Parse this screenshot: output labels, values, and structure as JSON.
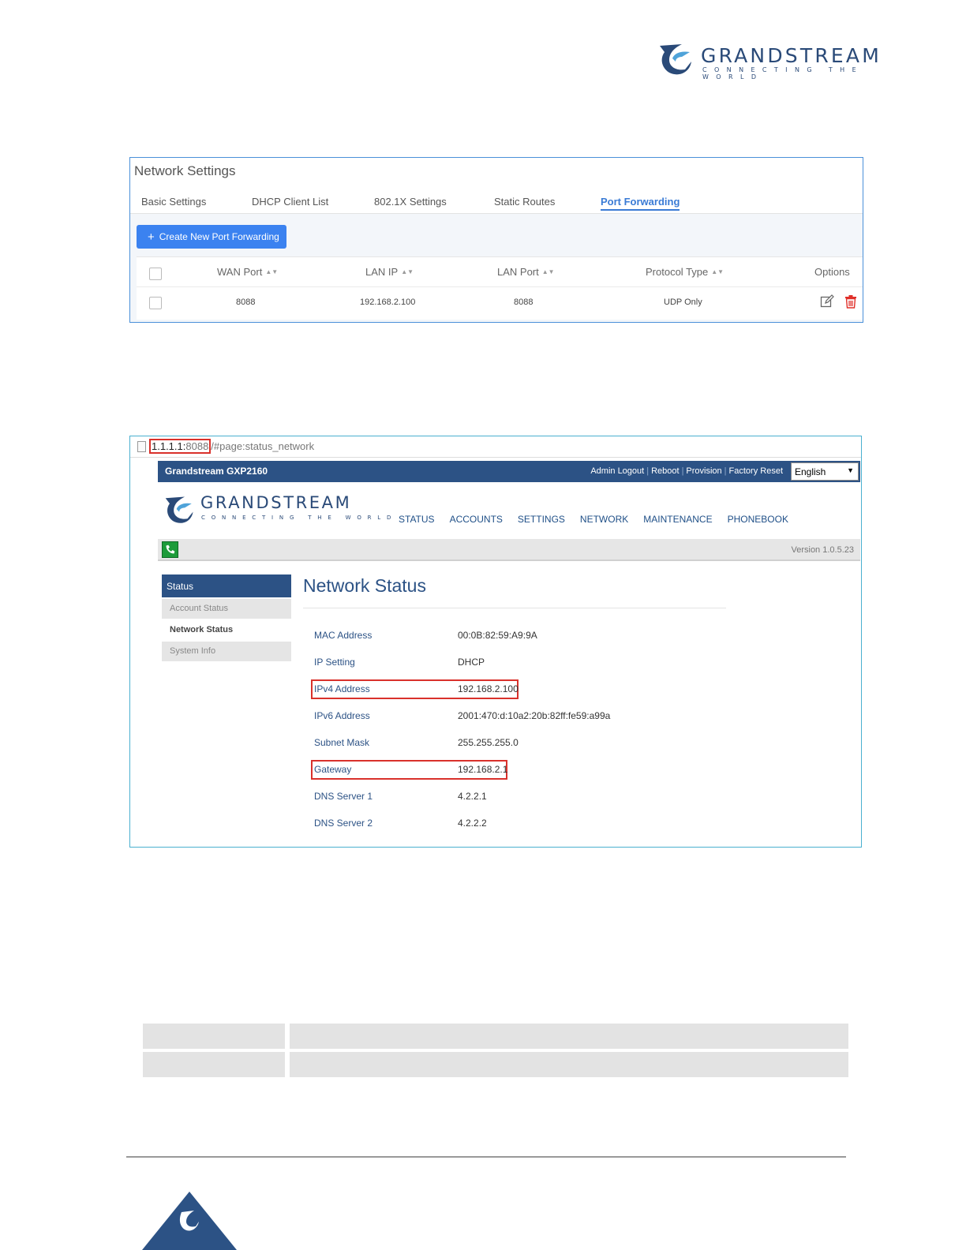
{
  "logo": {
    "wordmark": "GRANDSTREAM",
    "tagline": "CONNECTING THE WORLD",
    "icon": "grandstream-logo-icon"
  },
  "network_settings": {
    "title": "Network Settings",
    "tabs": [
      {
        "label": "Basic Settings",
        "active": false
      },
      {
        "label": "DHCP Client List",
        "active": false
      },
      {
        "label": "802.1X Settings",
        "active": false
      },
      {
        "label": "Static Routes",
        "active": false
      },
      {
        "label": "Port Forwarding",
        "active": true
      }
    ],
    "create_button": "Create New Port Forwarding",
    "columns": [
      "WAN Port",
      "LAN IP",
      "LAN Port",
      "Protocol Type",
      "Options"
    ],
    "rows": [
      {
        "wan_port": "8088",
        "lan_ip": "192.168.2.100",
        "lan_port": "8088",
        "protocol": "UDP Only"
      }
    ],
    "accent_color": "#3b82f0",
    "delete_color": "#e0302a"
  },
  "gxp": {
    "url_host": "1.1.1.1:",
    "url_port": "8088",
    "url_rest": "/#page:status_network",
    "brand": "Grandstream GXP2160",
    "top_links": [
      "Admin Logout",
      "Reboot",
      "Provision",
      "Factory Reset"
    ],
    "language": "English",
    "wordmark": "GRANDSTREAM",
    "tagline": "CONNECTING THE WORLD",
    "nav": [
      "STATUS",
      "ACCOUNTS",
      "SETTINGS",
      "NETWORK",
      "MAINTENANCE",
      "PHONEBOOK"
    ],
    "version": "Version 1.0.5.23",
    "sidebar": {
      "head": "Status",
      "items": [
        "Account Status",
        "Network Status",
        "System Info"
      ]
    },
    "heading": "Network Status",
    "fields": [
      {
        "label": "MAC Address",
        "value": "00:0B:82:59:A9:9A",
        "highlight": false
      },
      {
        "label": "IP Setting",
        "value": "DHCP",
        "highlight": false
      },
      {
        "label": "IPv4 Address",
        "value": "192.168.2.100",
        "highlight": true
      },
      {
        "label": "IPv6 Address",
        "value": "2001:470:d:10a2:20b:82ff:fe59:a99a",
        "highlight": false
      },
      {
        "label": "Subnet Mask",
        "value": "255.255.255.0",
        "highlight": false
      },
      {
        "label": "Gateway",
        "value": "192.168.2.1",
        "highlight": true
      },
      {
        "label": "DNS Server 1",
        "value": "4.2.2.1",
        "highlight": false
      },
      {
        "label": "DNS Server 2",
        "value": "4.2.2.2",
        "highlight": false
      }
    ],
    "brand_color": "#2c5285",
    "highlight_color": "#d9312b"
  }
}
